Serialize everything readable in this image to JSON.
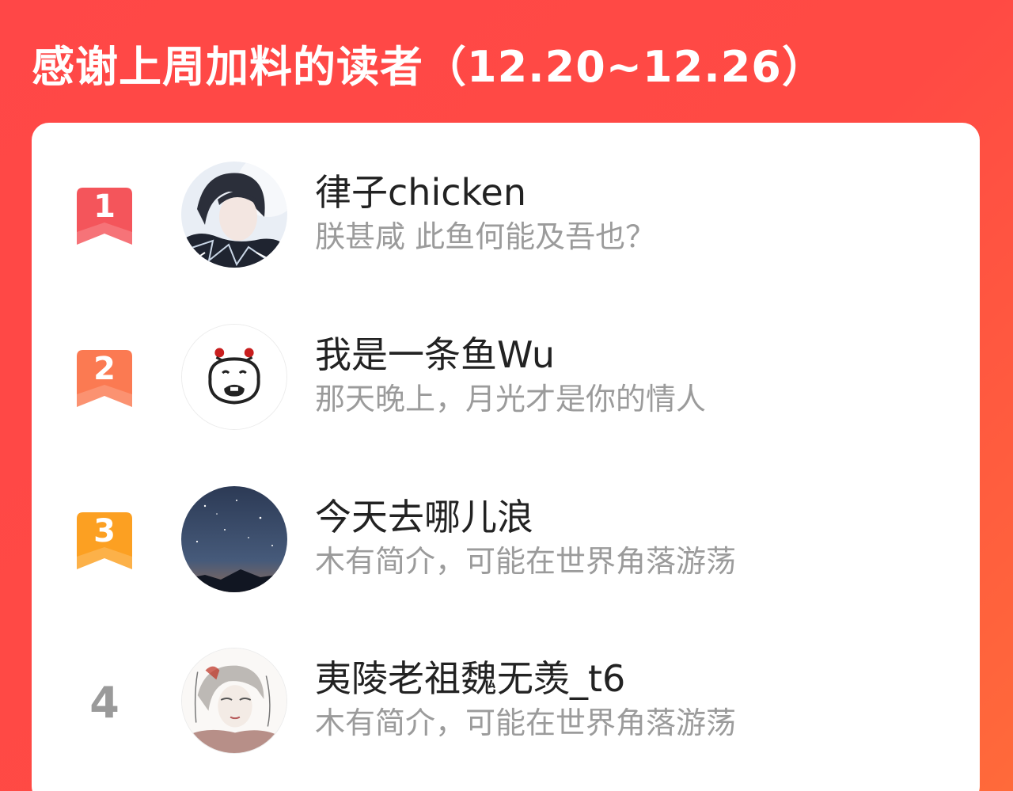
{
  "header": {
    "title": "感谢上周加料的读者（12.20~12.26）"
  },
  "readers": [
    {
      "rank": "1",
      "name": "律子chicken",
      "bio": "朕甚咸 此鱼何能及吾也？",
      "badge_color": "#f4555b",
      "avatar_icon": "anime-character-avatar"
    },
    {
      "rank": "2",
      "name": "我是一条鱼Wu",
      "bio": "那天晚上，月光才是你的情人",
      "badge_color": "#fb7a52",
      "avatar_icon": "cartoon-face-avatar"
    },
    {
      "rank": "3",
      "name": "今天去哪儿浪",
      "bio": "木有简介，可能在世界角落游荡",
      "badge_color": "#fca022",
      "avatar_icon": "night-sky-avatar"
    },
    {
      "rank": "4",
      "name": "夷陵老祖魏无羡_t6",
      "bio": "木有简介，可能在世界角落游荡",
      "badge_color": "",
      "avatar_icon": "sketch-character-avatar"
    }
  ],
  "colors": {
    "header_gradient_start": "#ff4747",
    "header_gradient_end": "#ff6a3a",
    "name_text": "#222222",
    "bio_text": "#9b9b9b",
    "plain_rank_text": "#9a9a9a"
  }
}
